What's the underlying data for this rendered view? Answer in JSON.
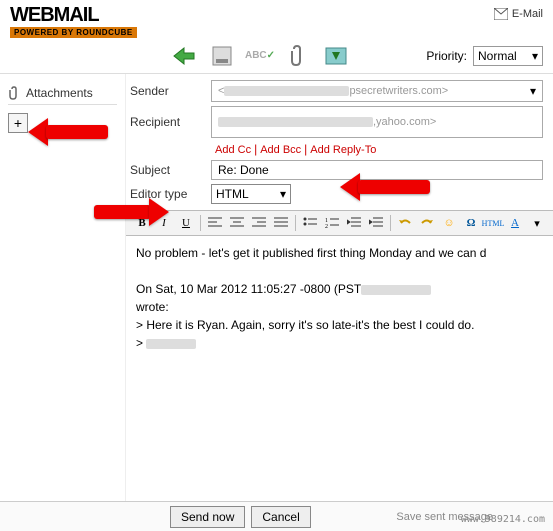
{
  "logo": {
    "top": "WEBMAIL",
    "bottom": "POWERED BY ROUNDCUBE"
  },
  "header": {
    "email_link": "E-Mail"
  },
  "toolbar": {
    "priority_label": "Priority:",
    "priority_value": "Normal"
  },
  "sidebar": {
    "attachments_label": "Attachments",
    "add_glyph": "+"
  },
  "fields": {
    "sender_label": "Sender",
    "sender_domain": "psecretwriters.com>",
    "recipient_label": "Recipient",
    "recipient_domain": ",yahoo.com>",
    "cc": "Add Cc",
    "bcc": "Add Bcc",
    "replyto": "Add Reply-To",
    "subject_label": "Subject",
    "subject_value": "Re: Done",
    "editor_label": "Editor type",
    "editor_value": "HTML"
  },
  "editor_buttons": {
    "bold": "B",
    "italic": "I",
    "underline": "U",
    "html": "HTML",
    "fontcolor": "A"
  },
  "body": {
    "line1": "No problem - let's get it published first thing Monday and we can d",
    "quote1": "On Sat, 10 Mar 2012 11:05:27 -0800 (PST",
    "quote2": "wrote:",
    "quote3": "> Here it is Ryan. Again, sorry it's so late-it's the best I could do.",
    "quote4": ">"
  },
  "footer": {
    "send": "Send now",
    "cancel": "Cancel",
    "save": "Save sent message"
  },
  "watermark": "www.989214.com"
}
